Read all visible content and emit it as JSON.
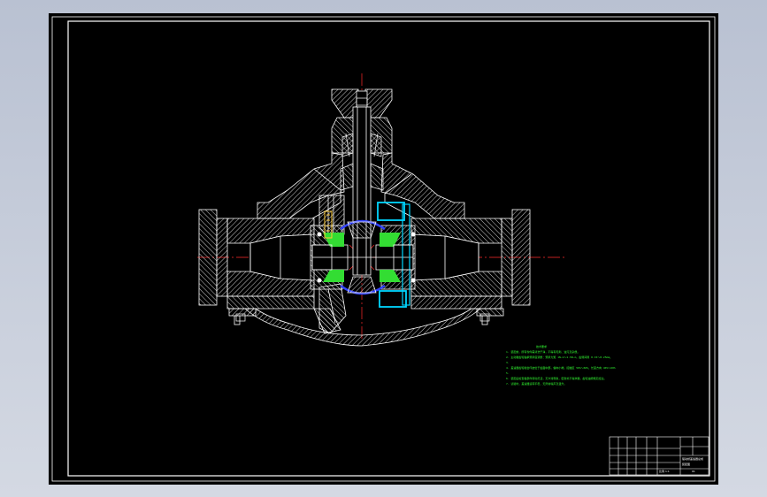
{
  "colors": {
    "background": "#000000",
    "outline": "#ffffff",
    "centerline": "#ff2a2a",
    "notes": "#33ff33",
    "bearing": "#00d6ff",
    "gear": "#33dd33",
    "spider": "#3344ff",
    "washer": "#ffcc33"
  },
  "technical_notes": {
    "title": "技术要求",
    "lines": [
      "1. 装配前，所有零件需清洗干净，不得有毛刺、油污及杂质。",
      "2. 主动锥齿轮轴承预紧度调整：预紧力矩 1N·m～1.5N·m，齿侧间隙 0.15～0.25mm。",
      "3.",
      "4. 差速器齿轮啮合印迹位于齿面中部，偏向小端，接触区 50%～60%，长度方向 40%～60%",
      "5.",
      "6. 装配后检查各部件转动灵活，无卡滞现象，密封处不得渗漏，齿轮油按规定加注。",
      "7. 试验时，差速器运转平稳，无异常噪声及温升。"
    ]
  },
  "title_block": {
    "drawing_name": "驱动桥差速器总成",
    "subtitle": "装配图",
    "number": "01",
    "scale_label": "比例 1:1"
  }
}
